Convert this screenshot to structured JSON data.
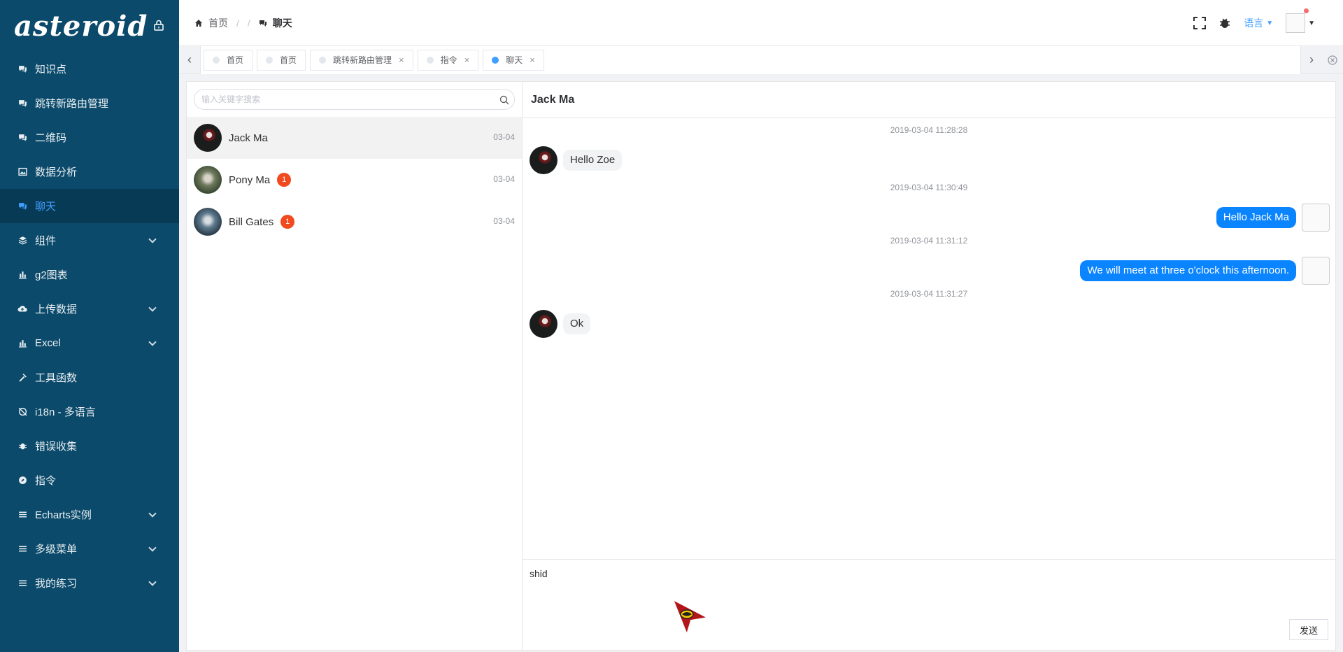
{
  "sidebar": {
    "logo": "asteroid",
    "items": [
      {
        "label": "知识点",
        "icon": "chat-icon",
        "has_children": false,
        "active": false
      },
      {
        "label": "跳转新路由管理",
        "icon": "chat-icon",
        "has_children": false,
        "active": false
      },
      {
        "label": "二维码",
        "icon": "chat-icon",
        "has_children": false,
        "active": false
      },
      {
        "label": "数据分析",
        "icon": "image-icon",
        "has_children": false,
        "active": false
      },
      {
        "label": "聊天",
        "icon": "chat-icon",
        "has_children": false,
        "active": true
      },
      {
        "label": "组件",
        "icon": "layers-icon",
        "has_children": true,
        "active": false
      },
      {
        "label": "g2图表",
        "icon": "bar-chart-icon",
        "has_children": false,
        "active": false
      },
      {
        "label": "上传数据",
        "icon": "cloud-upload-icon",
        "has_children": true,
        "active": false
      },
      {
        "label": "Excel",
        "icon": "bar-chart-icon",
        "has_children": true,
        "active": false
      },
      {
        "label": "工具函数",
        "icon": "hammer-icon",
        "has_children": false,
        "active": false
      },
      {
        "label": "i18n - 多语言",
        "icon": "globe-icon",
        "has_children": false,
        "active": false
      },
      {
        "label": "错误收集",
        "icon": "bug-icon",
        "has_children": false,
        "active": false
      },
      {
        "label": "指令",
        "icon": "compass-icon",
        "has_children": false,
        "active": false
      },
      {
        "label": "Echarts实例",
        "icon": "menu-icon",
        "has_children": true,
        "active": false
      },
      {
        "label": "多级菜单",
        "icon": "menu-icon",
        "has_children": true,
        "active": false
      },
      {
        "label": "我的练习",
        "icon": "menu-icon",
        "has_children": true,
        "active": false
      }
    ]
  },
  "header": {
    "breadcrumb": {
      "home": "首页",
      "sep1": "/",
      "sep2": "/",
      "current": "聊天"
    },
    "language": "语言"
  },
  "tabs": [
    {
      "label": "首页",
      "closable": false,
      "active": false
    },
    {
      "label": "首页",
      "closable": false,
      "active": false
    },
    {
      "label": "跳转新路由管理",
      "closable": true,
      "active": false
    },
    {
      "label": "指令",
      "closable": true,
      "active": false
    },
    {
      "label": "聊天",
      "closable": true,
      "active": true
    }
  ],
  "contacts": {
    "search_placeholder": "输入关键字搜索",
    "list": [
      {
        "name": "Jack Ma",
        "time": "03-04",
        "badge": "",
        "active": true
      },
      {
        "name": "Pony Ma",
        "time": "03-04",
        "badge": "1",
        "active": false
      },
      {
        "name": "Bill Gates",
        "time": "03-04",
        "badge": "1",
        "active": false
      }
    ]
  },
  "conversation": {
    "title": "Jack Ma",
    "messages": [
      {
        "timestamp": "2019-03-04 11:28:28",
        "text": "Hello Zoe",
        "side": "left"
      },
      {
        "timestamp": "2019-03-04 11:30:49",
        "text": "Hello Jack Ma",
        "side": "right"
      },
      {
        "timestamp": "2019-03-04 11:31:12",
        "text": "We will meet at three o'clock this afternoon.",
        "side": "right"
      },
      {
        "timestamp": "2019-03-04 11:31:27",
        "text": "Ok",
        "side": "left"
      }
    ],
    "draft": "shid",
    "send_label": "发送"
  }
}
